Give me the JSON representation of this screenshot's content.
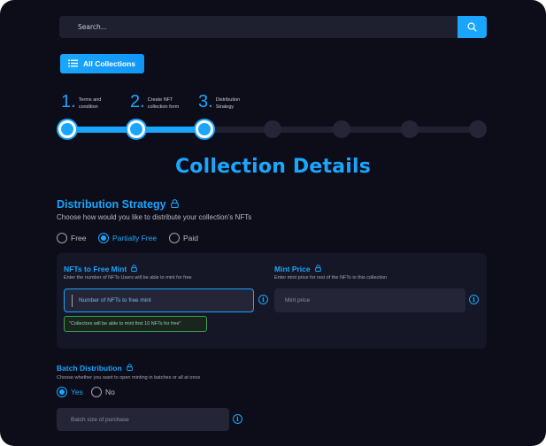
{
  "search": {
    "placeholder": "Search..."
  },
  "header": {
    "all_collections_label": "All Collections"
  },
  "stepper": {
    "steps": [
      {
        "num": "1.",
        "label": "Terms and condition"
      },
      {
        "num": "2.",
        "label": "Create NFT collection form"
      },
      {
        "num": "3.",
        "label": "Distribution Strategy"
      }
    ],
    "total_steps": 7,
    "completed_steps": 3
  },
  "page": {
    "title": "Collection Details"
  },
  "distribution": {
    "title": "Distribution Strategy",
    "subtitle": "Choose how would you like to distribute your collection's NFTs",
    "options": [
      "Free",
      "Partially Free",
      "Paid"
    ],
    "selected": "Partially Free"
  },
  "free_mint": {
    "label": "NFTs to Free Mint",
    "hint": "Enter the number of NFTs Users will be able to mint for free",
    "placeholder": "Number of NFTs to free mint",
    "tip": "\"Collectors will be able to mint first 10 NFTs for free\""
  },
  "mint_price": {
    "label": "Mint Price",
    "hint": "Enter mint price for rest of the NFTs in this collection",
    "placeholder": "Mint price"
  },
  "batch": {
    "label": "Batch Distribution",
    "hint": "Choose whether you want to open minting in batches or all at once",
    "options": [
      "Yes",
      "No"
    ],
    "selected": "Yes",
    "placeholder": "Batch size of purchase"
  },
  "colors": {
    "accent": "#1aa6ff",
    "background": "#0c0d19",
    "panel": "#151726",
    "success": "#3aa34a"
  }
}
